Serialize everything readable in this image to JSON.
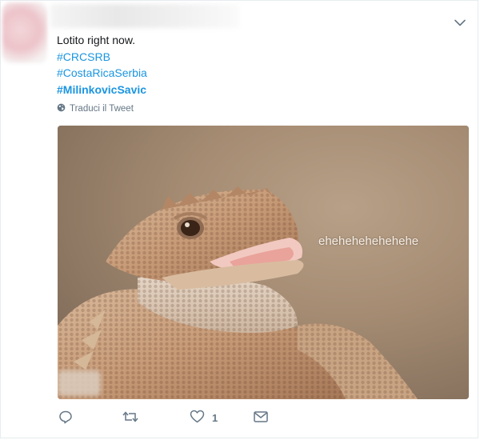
{
  "tweet": {
    "text": "Lotito right now.",
    "hashtags": [
      "#CRCSRB",
      "#CostaRicaSerbia",
      "#MilinkovicSavic"
    ],
    "translate_label": "Traduci il Tweet",
    "media": {
      "caption": "ehehehehehehehe"
    },
    "actions": {
      "like_count": "1"
    }
  },
  "icons": {
    "menu": "chevron-down-icon",
    "translate": "globe-icon",
    "reply": "reply-icon",
    "retweet": "retweet-icon",
    "like": "heart-icon",
    "dm": "envelope-icon"
  },
  "colors": {
    "link": "#1b95e0",
    "muted": "#657786",
    "text": "#14171a"
  }
}
